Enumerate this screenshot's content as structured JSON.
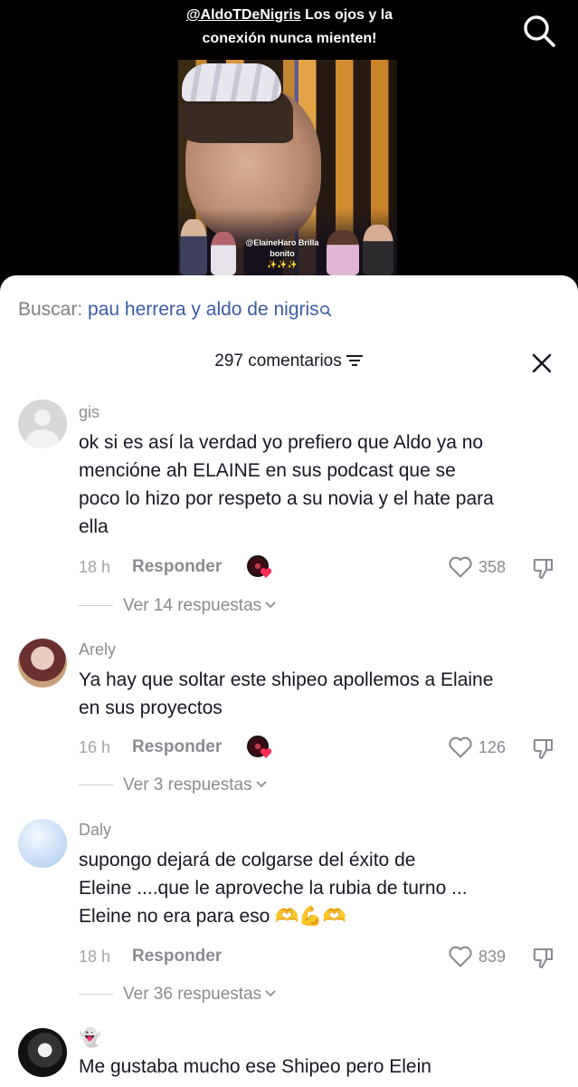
{
  "video": {
    "caption_mention": "@AldoTDeNigris",
    "caption_text": " Los ojos  y la",
    "caption_line2": "conexión nunca mienten!",
    "thumb_caption": "@ElaineHaro Brilla bonito",
    "thumb_sparkles": "✨✨✨",
    "search_icon": "search-icon"
  },
  "search": {
    "label": "Buscar: ",
    "query": "pau herrera y aldo de nigris",
    "icon": "search-small-icon"
  },
  "header": {
    "comment_count": "297 comentarios",
    "filter_icon": "filter-icon",
    "close_icon": "close-icon"
  },
  "comments": [
    {
      "username": "gis",
      "lines": [
        "ok si es así la verdad yo prefiero que Aldo ya no",
        "mencióne ah ELAINE en sus podcast que se",
        "poco lo hizo por respeto a su novia y el hate para",
        "ella"
      ],
      "time": "18 h",
      "reply_label": "Responder",
      "likes": "358",
      "replies": "Ver 14 respuestas"
    },
    {
      "username": "Arely",
      "lines": [
        "Ya hay que soltar este shipeo apollemos a Elaine",
        "en sus proyectos"
      ],
      "time": "16 h",
      "reply_label": "Responder",
      "likes": "126",
      "replies": "Ver 3 respuestas"
    },
    {
      "username": "Daly",
      "lines": [
        "supongo dejará de colgarse del éxito de",
        "Eleine ....que le aproveche la rubia de turno ...",
        "Eleine no era para eso 🫶💪🫶"
      ],
      "time": "18 h",
      "reply_label": "Responder",
      "likes": "839",
      "replies": "Ver 36 respuestas"
    },
    {
      "username_emoji": "👻",
      "lines": [
        "Me gustaba mucho ese Shipeo pero Elein"
      ]
    }
  ],
  "colors": {
    "background": "#000000",
    "sheet": "#ffffff",
    "text": "#161823",
    "muted": "#8a8b91",
    "link": "#3b5aa6",
    "heart": "#fe2c55"
  }
}
